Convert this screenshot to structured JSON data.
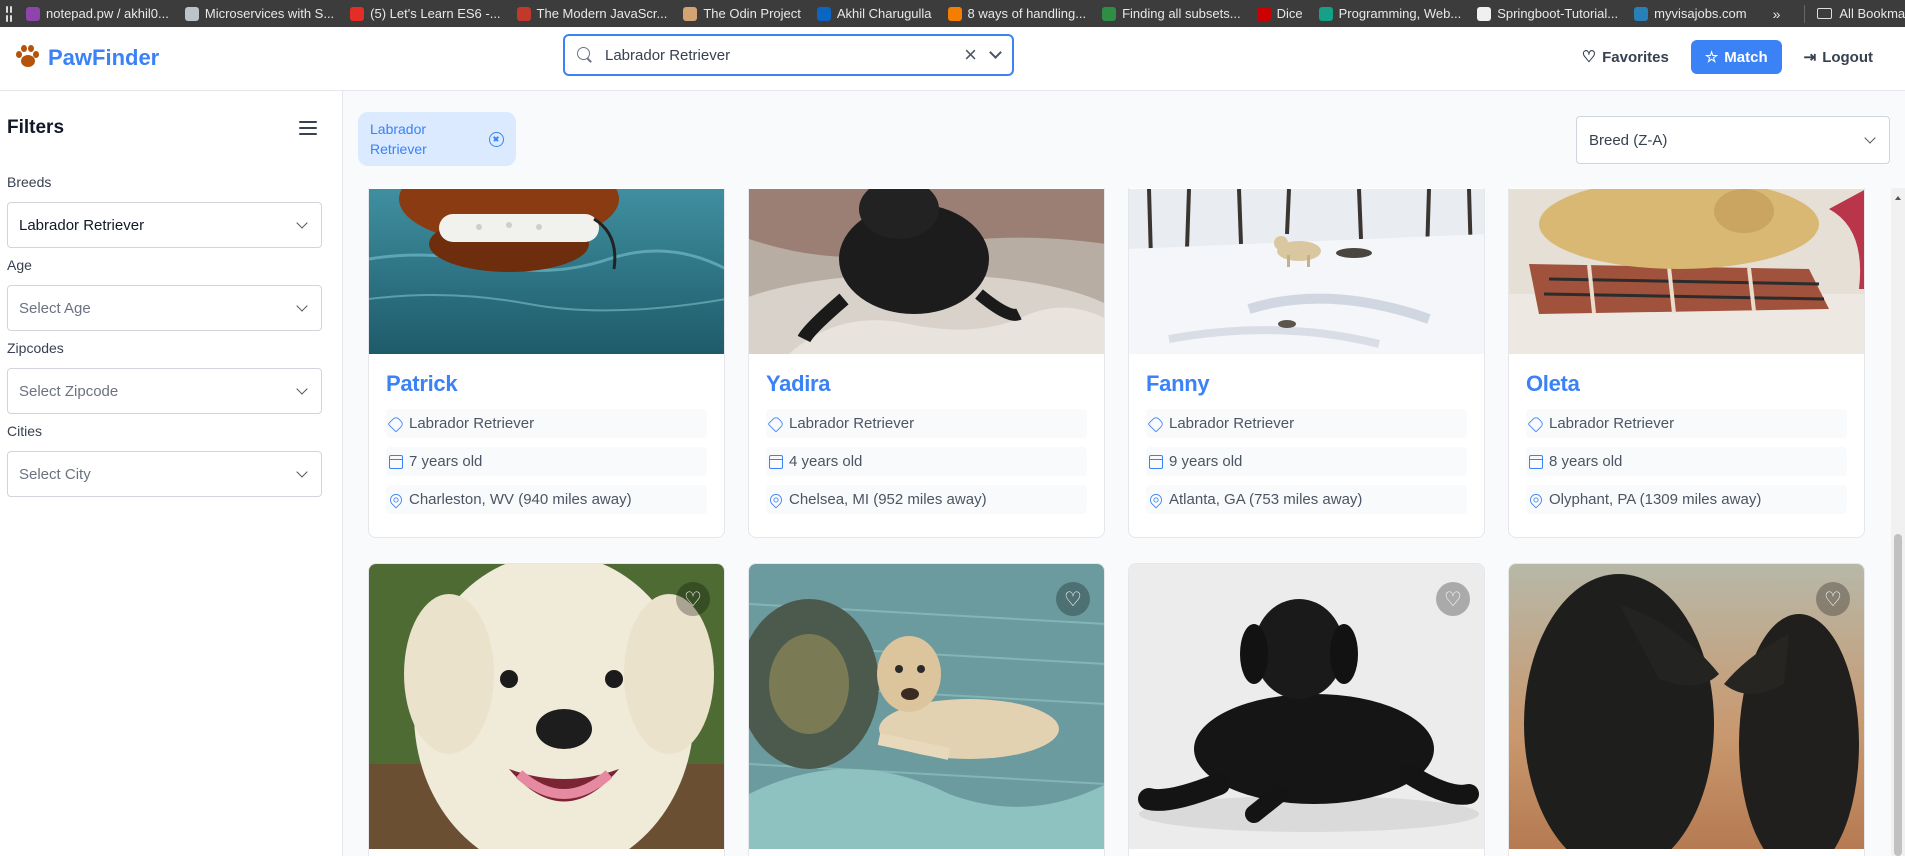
{
  "bookmarks": {
    "items": [
      {
        "label": "notepad.pw / akhil0...",
        "color": "#8e44ad"
      },
      {
        "label": "Microservices with S...",
        "color": "#bdc3c7"
      },
      {
        "label": "(5) Let's Learn ES6 -...",
        "color": "#e52d27"
      },
      {
        "label": "The Modern JavaScr...",
        "color": "#c0392b"
      },
      {
        "label": "The Odin Project",
        "color": "#d4a373"
      },
      {
        "label": "Akhil Charugulla",
        "color": "#0a66c2"
      },
      {
        "label": "8 ways of handling...",
        "color": "#f57d00"
      },
      {
        "label": "Finding all subsets...",
        "color": "#2f8d46"
      },
      {
        "label": "Dice",
        "color": "#cc0000"
      },
      {
        "label": "Programming, Web...",
        "color": "#16a085"
      },
      {
        "label": "Springboot-Tutorial...",
        "color": "#f0f0f0"
      },
      {
        "label": "myvisajobs.com",
        "color": "#2980b9"
      }
    ],
    "more": "»",
    "all_bookmarks": "All Bookmarks"
  },
  "header": {
    "brand": "PawFinder",
    "search_value": "Labrador Retriever",
    "favorites": "Favorites",
    "match": "Match",
    "logout": "Logout"
  },
  "sidebar": {
    "title": "Filters",
    "filters": [
      {
        "label": "Breeds",
        "value": "Labrador Retriever",
        "placeholder": false
      },
      {
        "label": "Age",
        "value": "Select Age",
        "placeholder": true
      },
      {
        "label": "Zipcodes",
        "value": "Select Zipcode",
        "placeholder": true
      },
      {
        "label": "Cities",
        "value": "Select City",
        "placeholder": true
      }
    ]
  },
  "main": {
    "chip": "Labrador Retriever",
    "sort": "Breed (Z-A)"
  },
  "cards": [
    {
      "name": "Patrick",
      "breed": "Labrador Retriever",
      "age": "7 years old",
      "location": "Charleston, WV (940 miles away)",
      "photo": "chocolate-lab-swimming"
    },
    {
      "name": "Yadira",
      "breed": "Labrador Retriever",
      "age": "4 years old",
      "location": "Chelsea, MI (952 miles away)",
      "photo": "black-lab-on-sand"
    },
    {
      "name": "Fanny",
      "breed": "Labrador Retriever",
      "age": "9 years old",
      "location": "Atlanta, GA (753 miles away)",
      "photo": "lab-in-snowy-woods"
    },
    {
      "name": "Oleta",
      "breed": "Labrador Retriever",
      "age": "8 years old",
      "location": "Olyphant, PA (1309 miles away)",
      "photo": "yellow-lab-on-couch"
    },
    {
      "photo": "white-lab-puppy"
    },
    {
      "photo": "yellow-lab-on-teal-blanket"
    },
    {
      "photo": "black-lab-lying-down"
    },
    {
      "photo": "two-black-labs"
    }
  ],
  "colors": {
    "accent": "#3b82f6",
    "chip_bg": "#dbeafe"
  }
}
